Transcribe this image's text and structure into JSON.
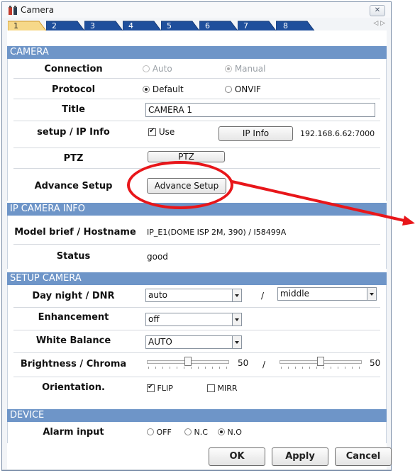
{
  "window": {
    "title": "Camera",
    "close_symbol": "✕"
  },
  "tabs": [
    {
      "label": "1",
      "active": true
    },
    {
      "label": "2"
    },
    {
      "label": "3"
    },
    {
      "label": "4"
    },
    {
      "label": "5"
    },
    {
      "label": "6"
    },
    {
      "label": "7"
    },
    {
      "label": "8"
    }
  ],
  "tab_scroll": "◁ ▷",
  "camera": {
    "header": "CAMERA",
    "connection": {
      "label": "Connection",
      "options": [
        "Auto",
        "Manual"
      ],
      "selected": "Manual",
      "disabled": true
    },
    "protocol": {
      "label": "Protocol",
      "options": [
        "Default",
        "ONVIF"
      ],
      "selected": "Default"
    },
    "title": {
      "label": "Title",
      "value": "CAMERA 1"
    },
    "setup_ip": {
      "label": "setup / IP Info",
      "use_label": "Use",
      "use_checked": true,
      "button": "IP Info",
      "address": "192.168.6.62:7000"
    },
    "ptz": {
      "label": "PTZ",
      "button": "PTZ"
    },
    "advance": {
      "label": "Advance Setup",
      "button": "Advance Setup"
    }
  },
  "ip_camera_info": {
    "header": "IP CAMERA INFO",
    "model": {
      "label": "Model brief / Hostname",
      "value": "IP_E1(DOME ISP 2M, 390) / I58499A"
    },
    "status": {
      "label": "Status",
      "value": "good"
    }
  },
  "setup_camera": {
    "header": "SETUP CAMERA",
    "day_night": {
      "label": "Day night / DNR",
      "value": "auto",
      "separator": "/",
      "dnr_value": "middle"
    },
    "enhancement": {
      "label": "Enhancement",
      "value": "off"
    },
    "white_balance": {
      "label": "White Balance",
      "value": "AUTO"
    },
    "brightness": {
      "label": "Brightness / Chroma",
      "brightness_value": "50",
      "separator": "/",
      "chroma_value": "50",
      "brightness_level": 0.5,
      "chroma_level": 0.5
    },
    "orientation": {
      "label": "Orientation.",
      "flip_label": "FLIP",
      "flip_checked": true,
      "mirr_label": "MIRR",
      "mirr_checked": false
    }
  },
  "device": {
    "header": "DEVICE",
    "alarm": {
      "label": "Alarm input",
      "options": [
        "OFF",
        "N.C",
        "N.O"
      ],
      "selected": "N.O"
    }
  },
  "footer": {
    "ok": "OK",
    "apply": "Apply",
    "cancel": "Cancel"
  },
  "annotation": {
    "highlight_color": "#e8161a"
  }
}
